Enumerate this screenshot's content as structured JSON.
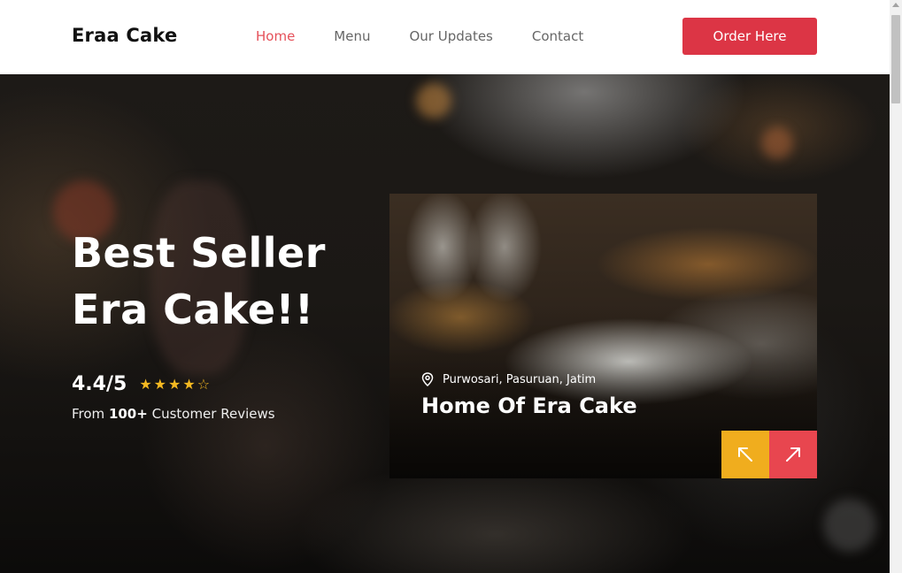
{
  "header": {
    "brand": "Eraa Cake",
    "nav": [
      {
        "label": "Home",
        "active": true
      },
      {
        "label": "Menu",
        "active": false
      },
      {
        "label": "Our Updates",
        "active": false
      },
      {
        "label": "Contact",
        "active": false
      }
    ],
    "order_button": "Order Here"
  },
  "hero": {
    "title_line1": "Best Seller",
    "title_line2": "Era Cake!!",
    "rating": "4.4/5",
    "stars": {
      "filled": 4,
      "total": 5
    },
    "reviews_prefix": "From ",
    "reviews_count": "100+",
    "reviews_suffix": " Customer Reviews"
  },
  "card": {
    "location": "Purwosari, Pasuruan, Jatim",
    "title": "Home Of Era Cake",
    "icons": {
      "location": "map-pin-icon",
      "prev": "arrow-up-left-icon",
      "next": "arrow-up-right-icon"
    }
  },
  "colors": {
    "accent_red": "#dc3545",
    "nav_active": "#e5515a",
    "star": "#f5b921",
    "arrow_prev": "#f0ad1e",
    "arrow_next": "#e8464f"
  }
}
